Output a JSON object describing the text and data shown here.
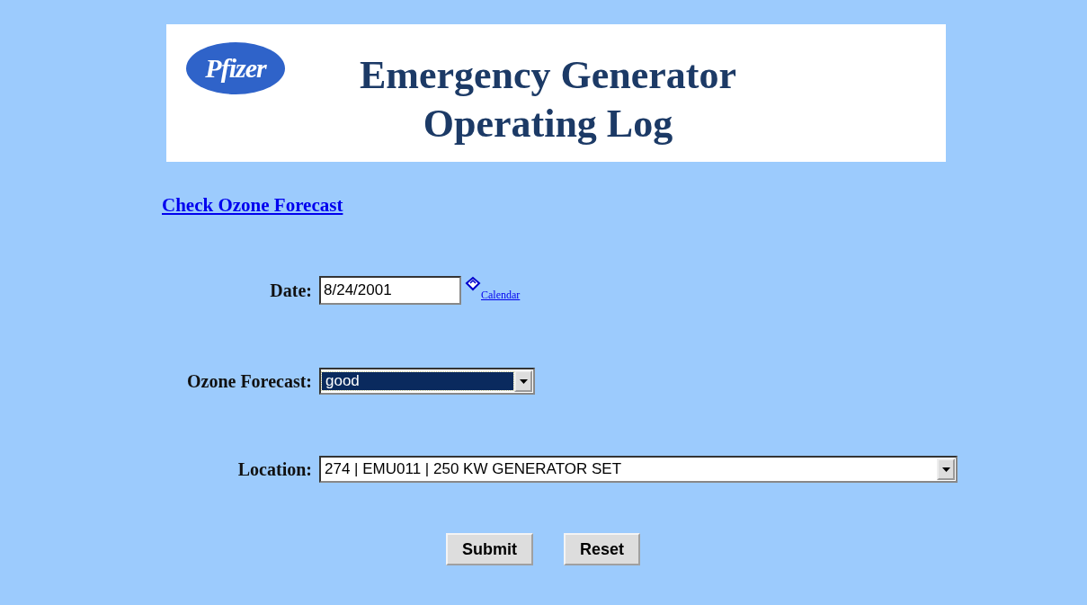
{
  "header": {
    "logo": "Pfizer",
    "title_lines": [
      "Emergency Generator",
      "Operating Log"
    ]
  },
  "link": "Check Ozone Forecast",
  "fields": [
    {
      "kind": "text",
      "label": "Date:",
      "value": "8/24/2001",
      "highlighted": false,
      "extra_link": "Calendar"
    },
    {
      "kind": "select",
      "label": "Ozone Forecast:",
      "value": "good",
      "highlighted": true
    },
    {
      "kind": "select",
      "label": "Location:",
      "value": "274 | EMU011 | 250 KW GENERATOR SET",
      "highlighted": false
    }
  ],
  "buttons": [
    "Submit",
    "Reset"
  ]
}
